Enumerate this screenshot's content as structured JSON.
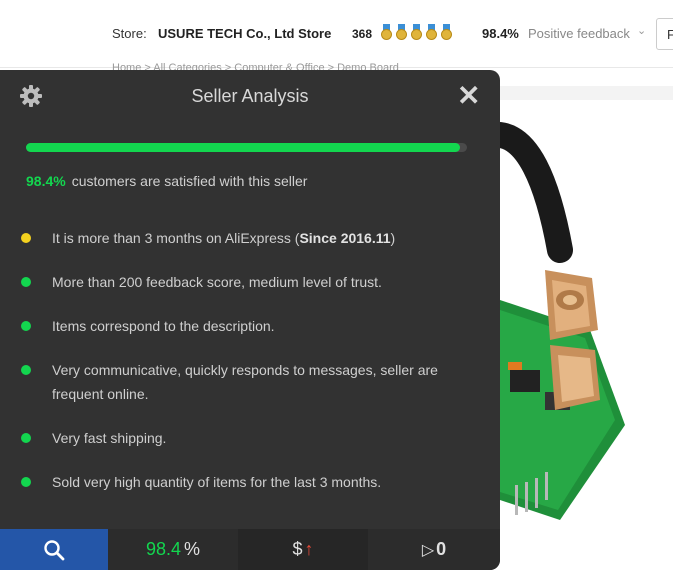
{
  "store_header": {
    "store_label": "Store:",
    "store_name": "USURE TECH Co., Ltd Store",
    "score": "368",
    "feedback_percent": "98.4%",
    "feedback_label": "Positive feedback",
    "right_box_text": "F",
    "breadcrumb": "Home > All Categories > Computer & Office > Demo Board"
  },
  "panel": {
    "title": "Seller Analysis",
    "satisfaction_fraction": 0.984,
    "satisfied_percent": "98.4%",
    "satisfied_text": "customers are satisfied with this seller",
    "criteria": [
      {
        "color": "#f4d21f",
        "text": "It is more than 3 months on AliExpress (",
        "bold": "Since 2016.11",
        "suffix": ")"
      },
      {
        "color": "#13d64f",
        "text": "More than 200 feedback score, medium level of trust."
      },
      {
        "color": "#13d64f",
        "text": "Items correspond to the description."
      },
      {
        "color": "#13d64f",
        "text": "Very communicative, quickly responds to messages, seller are frequent online."
      },
      {
        "color": "#13d64f",
        "text": "Very fast shipping."
      },
      {
        "color": "#13d64f",
        "text": "Sold very high quantity of items for the last 3 months."
      }
    ],
    "bottom_tabs": {
      "search_icon": "magnifier-icon",
      "percent_value": "98.4",
      "percent_sign": "%",
      "price_symbol": "$",
      "price_arrow": "↑",
      "play_symbol": "▷",
      "play_count": "0"
    }
  },
  "colors": {
    "panel_bg": "#323232",
    "accent_green": "#13d64f",
    "warning_yellow": "#f4d21f",
    "search_tab_blue": "#2456a8"
  }
}
